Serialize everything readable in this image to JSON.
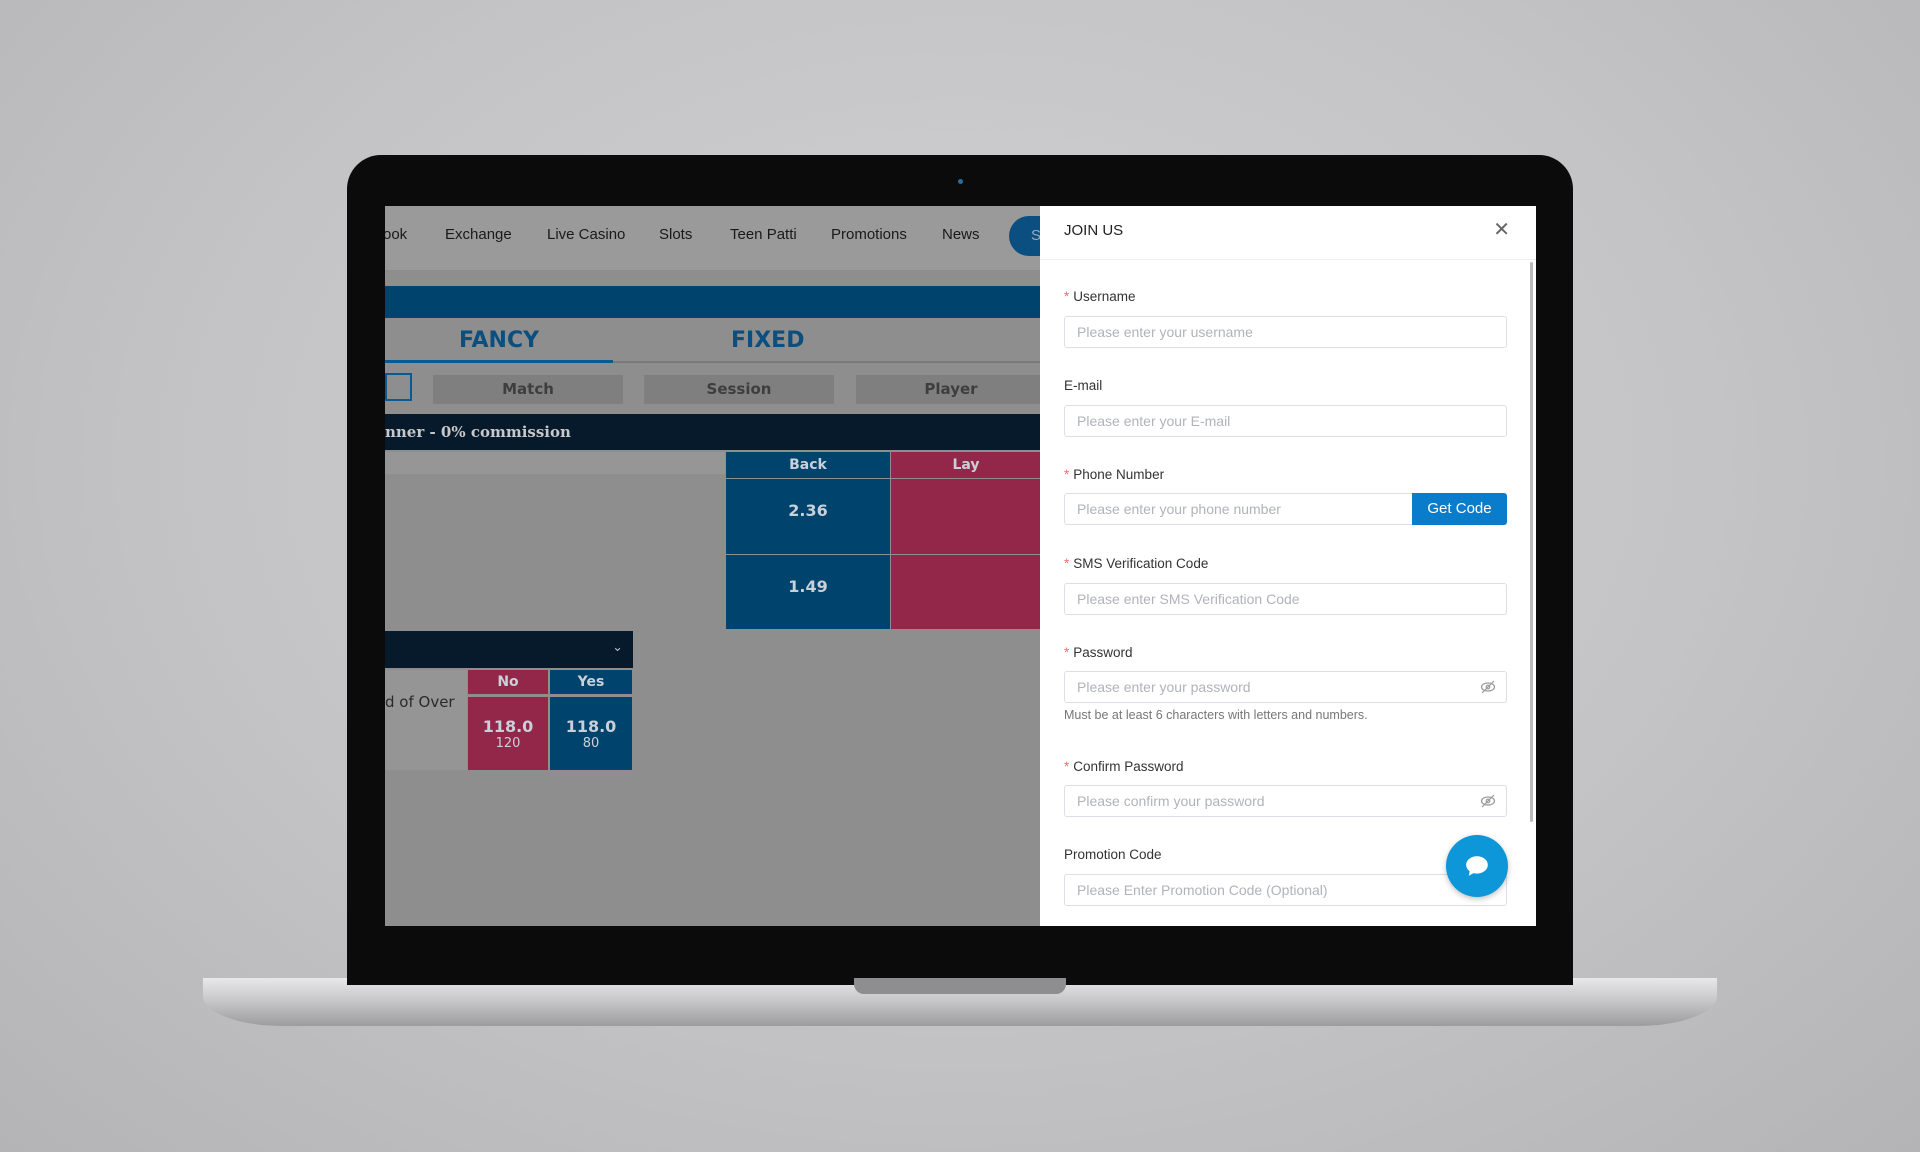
{
  "nav": {
    "items": [
      "ook",
      "Exchange",
      "Live Casino",
      "Slots",
      "Teen Patti",
      "Promotions",
      "News"
    ],
    "button_partial": "S"
  },
  "market": {
    "tabs": [
      "FANCY",
      "FIXED"
    ],
    "subtabs": [
      "Match",
      "Session",
      "Player"
    ],
    "title": "nner - 0% commission",
    "back_label": "Back",
    "lay_label": "Lay",
    "back_values": [
      "2.36",
      "1.49"
    ]
  },
  "session": {
    "runner": "d of Over",
    "no_label": "No",
    "yes_label": "Yes",
    "no_value": "118.0",
    "no_size": "120",
    "yes_value": "118.0",
    "yes_size": "80"
  },
  "modal": {
    "title": "JOIN US",
    "fields": [
      {
        "label": "Username",
        "required": true,
        "placeholder": "Please enter your username"
      },
      {
        "label": "E-mail",
        "required": false,
        "placeholder": "Please enter your E-mail"
      },
      {
        "label": "Phone Number",
        "required": true,
        "placeholder": "Please enter your phone number"
      },
      {
        "label": "SMS Verification Code",
        "required": true,
        "placeholder": "Please enter SMS Verification Code"
      },
      {
        "label": "Password",
        "required": true,
        "placeholder": "Please enter your password"
      },
      {
        "label": "Confirm Password",
        "required": true,
        "placeholder": "Please confirm your password"
      },
      {
        "label": "Promotion Code",
        "required": false,
        "placeholder": "Please Enter Promotion Code (Optional)"
      }
    ],
    "get_code": "Get Code",
    "password_hint": "Must be at least 6 characters with letters and numbers.",
    "required_mark": "*"
  },
  "colors": {
    "back": "#00446e",
    "lay": "#93274a",
    "primary": "#0a7ccc",
    "chat": "#0d96d8"
  }
}
